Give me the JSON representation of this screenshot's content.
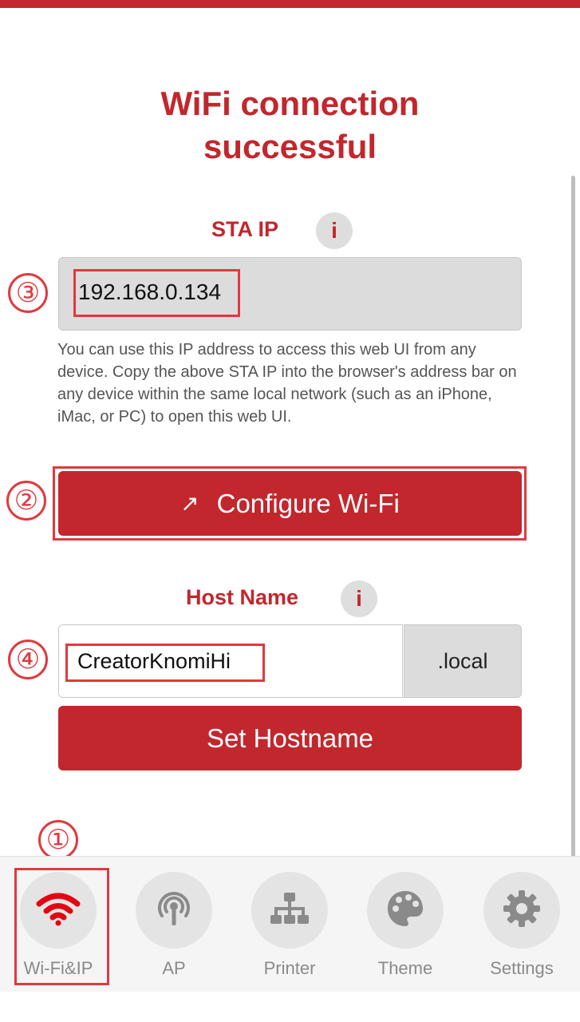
{
  "header": {
    "title_line1": "WiFi connection",
    "title_line2": "successful"
  },
  "sta": {
    "label": "STA IP",
    "info_icon": "i",
    "ip": "192.168.0.134",
    "hint": "You can use this IP address to access this web UI from any device. Copy the above STA IP into the browser's address bar on any device within the same local network (such as an iPhone, iMac, or PC) to open this web UI."
  },
  "configure": {
    "arrow": "↗",
    "label": "Configure Wi-Fi"
  },
  "host": {
    "label": "Host Name",
    "info_icon": "i",
    "value": "CreatorKnomiHi",
    "suffix": ".local",
    "button": "Set Hostname"
  },
  "annotations": {
    "n1": "①",
    "n2": "②",
    "n3": "③",
    "n4": "④"
  },
  "nav": {
    "items": [
      {
        "label": "Wi-Fi&IP",
        "icon": "wifi-icon",
        "active": true
      },
      {
        "label": "AP",
        "icon": "antenna-icon",
        "active": false
      },
      {
        "label": "Printer",
        "icon": "network-tree-icon",
        "active": false
      },
      {
        "label": "Theme",
        "icon": "palette-icon",
        "active": false
      },
      {
        "label": "Settings",
        "icon": "gear-icon",
        "active": false
      }
    ]
  },
  "colors": {
    "accent": "#c1272d",
    "annotation": "#e0393e",
    "nav_icon": "#8a8a8a"
  }
}
